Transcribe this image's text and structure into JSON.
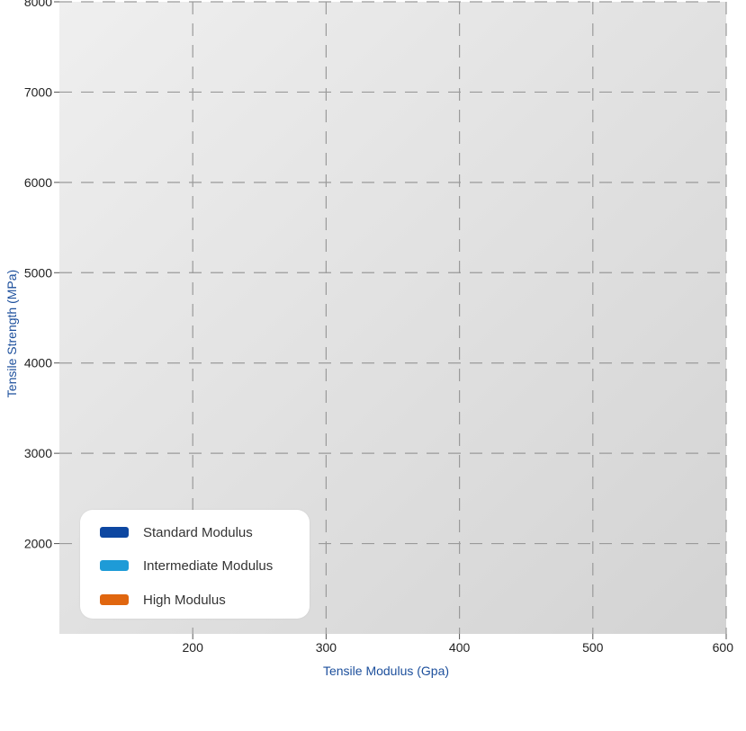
{
  "chart_data": {
    "type": "scatter",
    "title": "",
    "xlabel": "Tensile Modulus (Gpa)",
    "ylabel": "Tensile Strength (MPa)",
    "xlim": [
      100,
      600
    ],
    "ylim": [
      1000,
      8000
    ],
    "x_ticks": [
      200,
      300,
      400,
      500,
      600
    ],
    "y_ticks": [
      2000,
      3000,
      4000,
      5000,
      6000,
      7000,
      8000
    ],
    "grid": true,
    "grid_style": "dashed",
    "legend_placement": "bottom-left",
    "series": [
      {
        "name": "Standard Modulus",
        "color": "#0d47a1",
        "points": []
      },
      {
        "name": "Intermediate Modulus",
        "color": "#1e9bd7",
        "points": []
      },
      {
        "name": "High Modulus",
        "color": "#e0660f",
        "points": []
      }
    ]
  }
}
